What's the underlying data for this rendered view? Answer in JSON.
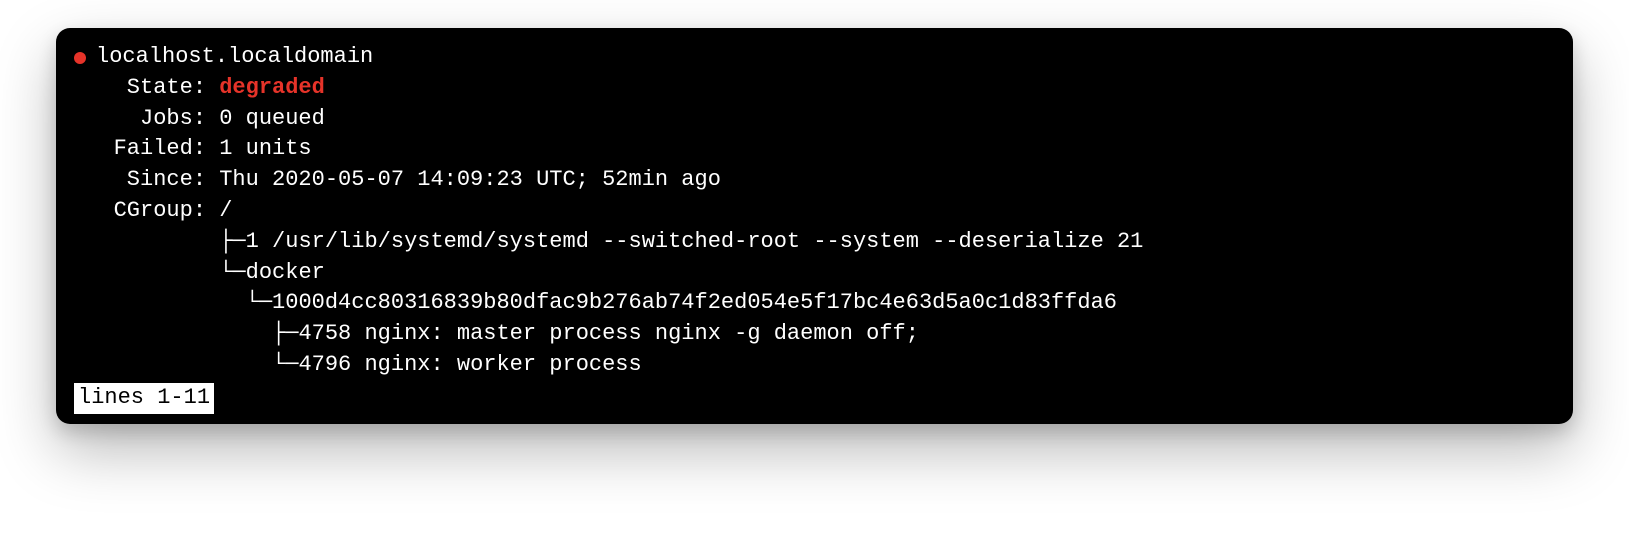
{
  "host": "localhost.localdomain",
  "fields": {
    "state": {
      "label": "State",
      "value": "degraded"
    },
    "jobs": {
      "label": "Jobs",
      "value": "0 queued"
    },
    "failed": {
      "label": "Failed",
      "value": "1 units"
    },
    "since": {
      "label": "Since",
      "value": "Thu 2020-05-07 14:09:23 UTC; 52min ago"
    },
    "cgroup": {
      "label": "CGroup",
      "value": "/"
    }
  },
  "tree": {
    "l1": "├─1 /usr/lib/systemd/systemd --switched-root --system --deserialize 21",
    "l2": "└─docker",
    "l3": "  └─1000d4cc80316839b80dfac9b276ab74f2ed054e5f17bc4e63d5a0c1d83ffda6",
    "l4": "    ├─4758 nginx: master process nginx -g daemon off;",
    "l5": "    └─4796 nginx: worker process"
  },
  "pager": "lines 1-11",
  "colors": {
    "accent_red": "#e63329"
  }
}
